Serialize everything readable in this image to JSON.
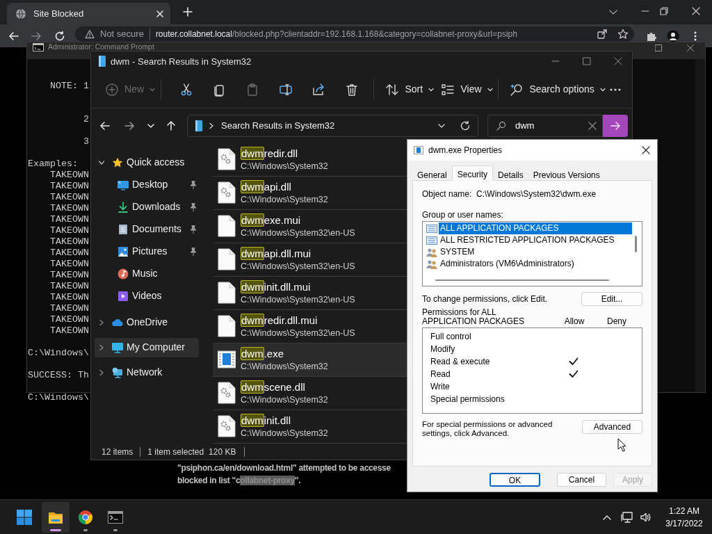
{
  "browser": {
    "tab_title": "Site Blocked",
    "security": "Not secure",
    "url_host": "router.collabnet.local",
    "url_path": "/blocked.php?clientaddr=192.168.1.168&category=collabnet-proxy&url=psiph",
    "message_line_1": "\"psiphon.ca/en/download.html\" attempted to be accesse",
    "message_line_2": {
      "before": "blocked in list \"c",
      "selected": "ollabnet-proxy",
      "after": "\"."
    }
  },
  "terminal": {
    "title": "Administrator: Command Prompt",
    "blocks": [
      [
        "    NOTE: 1"
      ],
      [
        "          2"
      ],
      [
        "          3"
      ],
      [
        "Examples:",
        "    TAKEOWN",
        "    TAKEOWN",
        "    TAKEOWN",
        "    TAKEOWN",
        "    TAKEOWN",
        "    TAKEOWN",
        "    TAKEOWN",
        "    TAKEOWN",
        "    TAKEOWN",
        "    TAKEOWN",
        "    TAKEOWN",
        "    TAKEOWN",
        "    TAKEOWN",
        "    TAKEOWN",
        "    TAKEOWN"
      ],
      [
        "C:\\Windows\\"
      ],
      [
        "SUCCESS: Th"
      ],
      [
        "C:\\Windows\\"
      ]
    ]
  },
  "explorer": {
    "title": "dwm - Search Results in System32",
    "toolbar": [
      {
        "kind": "new",
        "label": "New",
        "disabled": true
      },
      {
        "kind": "cut",
        "disabled": false
      },
      {
        "kind": "copy",
        "disabled": false
      },
      {
        "kind": "paste",
        "disabled": true
      },
      {
        "kind": "rename",
        "disabled": false
      },
      {
        "kind": "share",
        "disabled": false
      },
      {
        "kind": "delete",
        "disabled": false
      },
      {
        "kind": "sort",
        "label": "Sort",
        "disabled": false
      },
      {
        "kind": "view",
        "label": "View",
        "disabled": false
      },
      {
        "kind": "search_options",
        "label": "Search options",
        "disabled": false
      },
      {
        "kind": "more",
        "disabled": false
      }
    ],
    "address": "Search Results in System32",
    "search": {
      "value": "dwm"
    },
    "navigation": [
      {
        "kind": "star",
        "label": "Quick access",
        "expanded": true,
        "selected": false,
        "children": [
          {
            "kind": "desktop",
            "label": "Desktop",
            "pinned": true,
            "selected": false
          },
          {
            "kind": "download",
            "label": "Downloads",
            "pinned": true,
            "selected": false
          },
          {
            "kind": "document",
            "label": "Documents",
            "pinned": true,
            "selected": false
          },
          {
            "kind": "picture",
            "label": "Pictures",
            "pinned": true,
            "selected": false
          },
          {
            "kind": "music",
            "label": "Music",
            "pinned": false,
            "selected": false
          },
          {
            "kind": "video",
            "label": "Videos",
            "pinned": false,
            "selected": false
          }
        ]
      },
      {
        "kind": "cloud",
        "label": "OneDrive",
        "expanded": false,
        "selected": false
      },
      {
        "kind": "computer",
        "label": "My Computer",
        "expanded": false,
        "selected": true
      },
      {
        "kind": "network",
        "label": "Network",
        "expanded": false,
        "selected": false
      }
    ],
    "files": [
      {
        "kind": "dll",
        "match": "dwm",
        "rest": "redir.dll",
        "path": "C:\\Windows\\System32",
        "selected": false
      },
      {
        "kind": "dll",
        "match": "dwm",
        "rest": "api.dll",
        "path": "C:\\Windows\\System32",
        "selected": false
      },
      {
        "kind": "mui",
        "match": "dwm",
        "rest": "exe.mui",
        "path": "C:\\Windows\\System32\\en-US",
        "selected": false
      },
      {
        "kind": "mui",
        "match": "dwm",
        "rest": "api.dll.mui",
        "path": "C:\\Windows\\System32\\en-US",
        "selected": false
      },
      {
        "kind": "mui",
        "match": "dwm",
        "rest": "init.dll.mui",
        "path": "C:\\Windows\\System32\\en-US",
        "selected": false
      },
      {
        "kind": "mui",
        "match": "dwm",
        "rest": "redir.dll.mui",
        "path": "C:\\Windows\\System32\\en-US",
        "selected": false
      },
      {
        "kind": "exe",
        "match": "dwm",
        "rest": ".exe",
        "path": "C:\\Windows\\System32",
        "selected": true
      },
      {
        "kind": "dll",
        "match": "dwm",
        "rest": "scene.dll",
        "path": "C:\\Windows\\System32",
        "selected": false
      },
      {
        "kind": "dll",
        "match": "dwm",
        "rest": "init.dll",
        "path": "C:\\Windows\\System32",
        "selected": false
      }
    ],
    "status": {
      "count": "12 items",
      "selection": "1 item selected",
      "size": "120 KB"
    }
  },
  "dialog": {
    "title": "dwm.exe Properties",
    "tabs": [
      {
        "label": "General",
        "selected": false
      },
      {
        "label": "Security",
        "selected": true
      },
      {
        "label": "Details",
        "selected": false
      },
      {
        "label": "Previous Versions",
        "selected": false
      }
    ],
    "object_label": "Object name:",
    "object_value": "C:\\Windows\\System32\\dwm.exe",
    "groups_label": "Group or user names:",
    "groups": [
      {
        "kind": "package",
        "name": "ALL APPLICATION PACKAGES",
        "selected": true
      },
      {
        "kind": "package",
        "name": "ALL RESTRICTED APPLICATION PACKAGES",
        "selected": false
      },
      {
        "kind": "users",
        "name": "SYSTEM",
        "selected": false
      },
      {
        "kind": "users",
        "name": "Administrators (VM6\\Administrators)",
        "selected": false
      }
    ],
    "edit_hint": "To change permissions, click Edit.",
    "edit_button": "Edit...",
    "permissions_label": "Permissions for ALL APPLICATION PACKAGES",
    "allow_label": "Allow",
    "deny_label": "Deny",
    "permissions": [
      {
        "name": "Full control",
        "allow": false,
        "deny": false
      },
      {
        "name": "Modify",
        "allow": false,
        "deny": false
      },
      {
        "name": "Read & execute",
        "allow": true,
        "deny": false
      },
      {
        "name": "Read",
        "allow": true,
        "deny": false
      },
      {
        "name": "Write",
        "allow": false,
        "deny": false
      },
      {
        "name": "Special permissions",
        "allow": false,
        "deny": false
      }
    ],
    "advanced_hint": "For special permissions or advanced settings, click Advanced.",
    "advanced_button": "Advanced",
    "buttons": [
      {
        "label": "OK",
        "default": true,
        "disabled": false
      },
      {
        "label": "Cancel",
        "default": false,
        "disabled": false
      },
      {
        "label": "Apply",
        "default": false,
        "disabled": true
      }
    ]
  },
  "taskbar": {
    "apps": [
      {
        "kind": "start",
        "active": false,
        "running": false
      },
      {
        "kind": "explorer",
        "active": true,
        "running": true
      },
      {
        "kind": "chrome",
        "active": false,
        "running": true
      },
      {
        "kind": "terminal",
        "active": false,
        "running": true
      }
    ],
    "clock": {
      "time": "1:22 AM",
      "date": "3/17/2022"
    }
  }
}
